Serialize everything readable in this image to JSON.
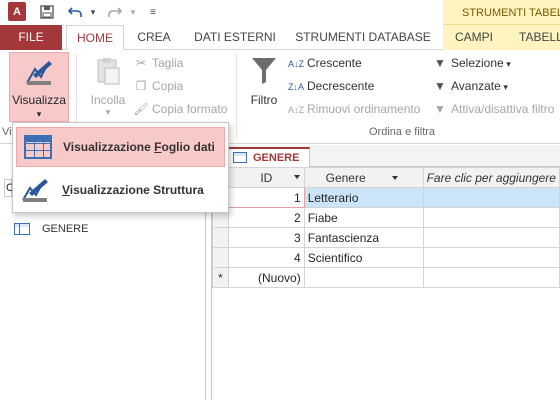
{
  "qat": {
    "app_icon": "access-logo-icon",
    "app_letter": "A",
    "icons": [
      "save-icon",
      "undo-icon",
      "dropdown-icon",
      "redo-icon",
      "dropdown-icon",
      "customize-icon"
    ]
  },
  "contextual_group": "STRUMENTI TABELLA",
  "tabs": [
    {
      "label": "FILE"
    },
    {
      "label": "HOME"
    },
    {
      "label": "CREA"
    },
    {
      "label": "DATI ESTERNI"
    },
    {
      "label": "STRUMENTI DATABASE"
    },
    {
      "label": "CAMPI"
    },
    {
      "label": "TABELLA"
    }
  ],
  "ribbon": {
    "visualizza": "Visualizza",
    "incolla": "Incolla",
    "taglia": "Taglia",
    "copia": "Copia",
    "copia_formato": "Copia formato",
    "filtro": "Filtro",
    "crescente": "Crescente",
    "decrescente": "Decrescente",
    "rimuovi_ordinamento": "Rimuovi ordinamento",
    "selezione": "Selezione",
    "avanzate": "Avanzate",
    "attiva_filtro": "Attiva/disattiva filtro",
    "group_views": "Vi",
    "group_sort": "Ordina e filtra"
  },
  "menu": {
    "datasheet": {
      "before": "Visualizzazione ",
      "key": "F",
      "after": "oglio dati"
    },
    "design": {
      "before": "",
      "key": "V",
      "after": "isualizzazione Struttura"
    }
  },
  "nav": {
    "item": "GENERE",
    "partial_label": "C"
  },
  "document": {
    "tab": "GENERE",
    "columns": {
      "id": "ID",
      "genere": "Genere",
      "add": "Fare clic per aggiungere"
    },
    "rows": [
      {
        "id": "1",
        "genere": "Letterario"
      },
      {
        "id": "2",
        "genere": "Fiabe"
      },
      {
        "id": "3",
        "genere": "Fantascienza"
      },
      {
        "id": "4",
        "genere": "Scientifico"
      }
    ],
    "new_row_marker": "*",
    "new_row_label": "(Nuovo)"
  },
  "colors": {
    "accent": "#a4373a",
    "menu_hover": "#f8c9c9",
    "contextual": "#fff4c0",
    "selected_row": "#cce4f7",
    "id_header": "#ffe88e"
  }
}
